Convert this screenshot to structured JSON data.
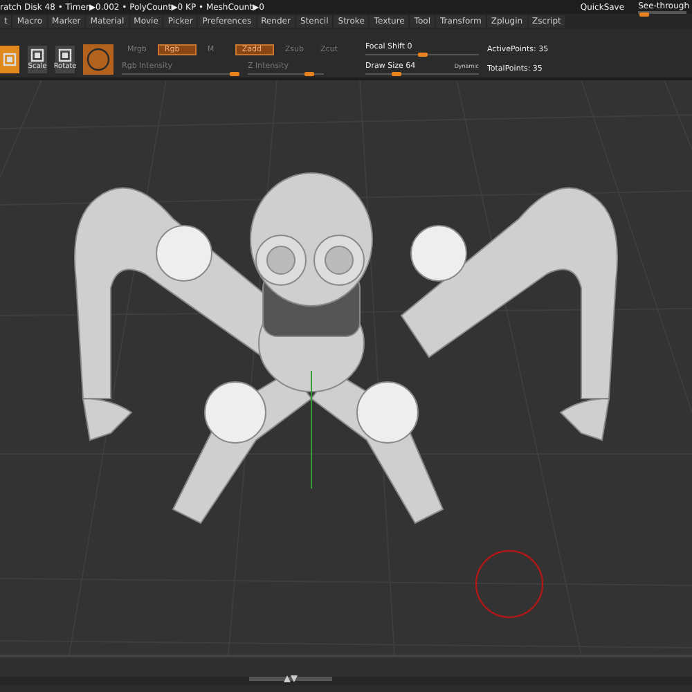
{
  "title_bar": {
    "info": "ratch Disk 48 • Timer▶0.002 • PolyCount▶0 KP • MeshCount▶0",
    "quicksave": "QuickSave",
    "see_through": {
      "label": "See-through",
      "level": 0.1
    }
  },
  "menu": [
    "t",
    "Macro",
    "Marker",
    "Material",
    "Movie",
    "Picker",
    "Preferences",
    "Render",
    "Stencil",
    "Stroke",
    "Texture",
    "Tool",
    "Transform",
    "Zplugin",
    "Zscript"
  ],
  "tools": [
    {
      "selected": true
    },
    {
      "label": "Scale",
      "selected": false
    },
    {
      "label": "Rotate",
      "selected": false
    }
  ],
  "color_toggles": [
    {
      "label": "Mrgb",
      "on": false
    },
    {
      "label": "Rgb",
      "on": true
    },
    {
      "label": "M",
      "on": false
    }
  ],
  "z_toggles": [
    {
      "label": "Zadd",
      "on": true
    },
    {
      "label": "Zsub",
      "on": false
    },
    {
      "label": "Zcut",
      "on": false
    }
  ],
  "rgb_intensity": {
    "label": "Rgb Intensity",
    "level": 0.95
  },
  "z_intensity": {
    "label": "Z Intensity",
    "level": 0.8
  },
  "focal_shift": {
    "label": "Focal Shift 0",
    "level": 0.5
  },
  "draw_size": {
    "label": "Draw Size 64",
    "level": 0.27,
    "badge": "Dynamic"
  },
  "stats": [
    "ActivePoints: 35",
    "TotalPoints: 35"
  ]
}
